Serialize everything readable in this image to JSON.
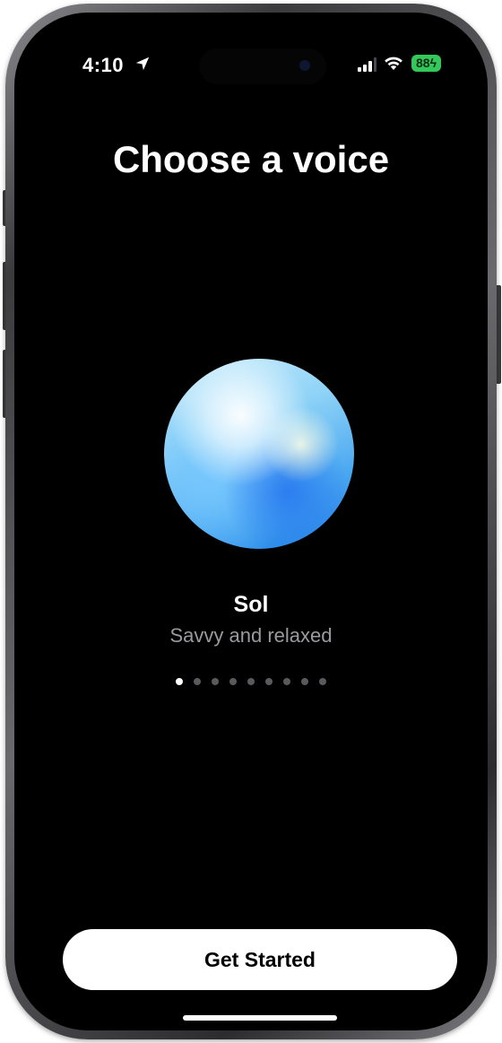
{
  "status_bar": {
    "time": "4:10",
    "battery": "88"
  },
  "title": "Choose a voice",
  "voice": {
    "name": "Sol",
    "description": "Savvy and relaxed"
  },
  "pagination": {
    "total": 9,
    "active_index": 0
  },
  "cta": {
    "label": "Get Started"
  },
  "colors": {
    "screen_background": "#000000",
    "battery": "#34c759",
    "button_background": "#ffffff",
    "secondary_text": "#9a9a9e"
  },
  "icons": [
    "location-arrow-icon",
    "cellular-signal-icon",
    "wifi-icon",
    "battery-icon"
  ]
}
